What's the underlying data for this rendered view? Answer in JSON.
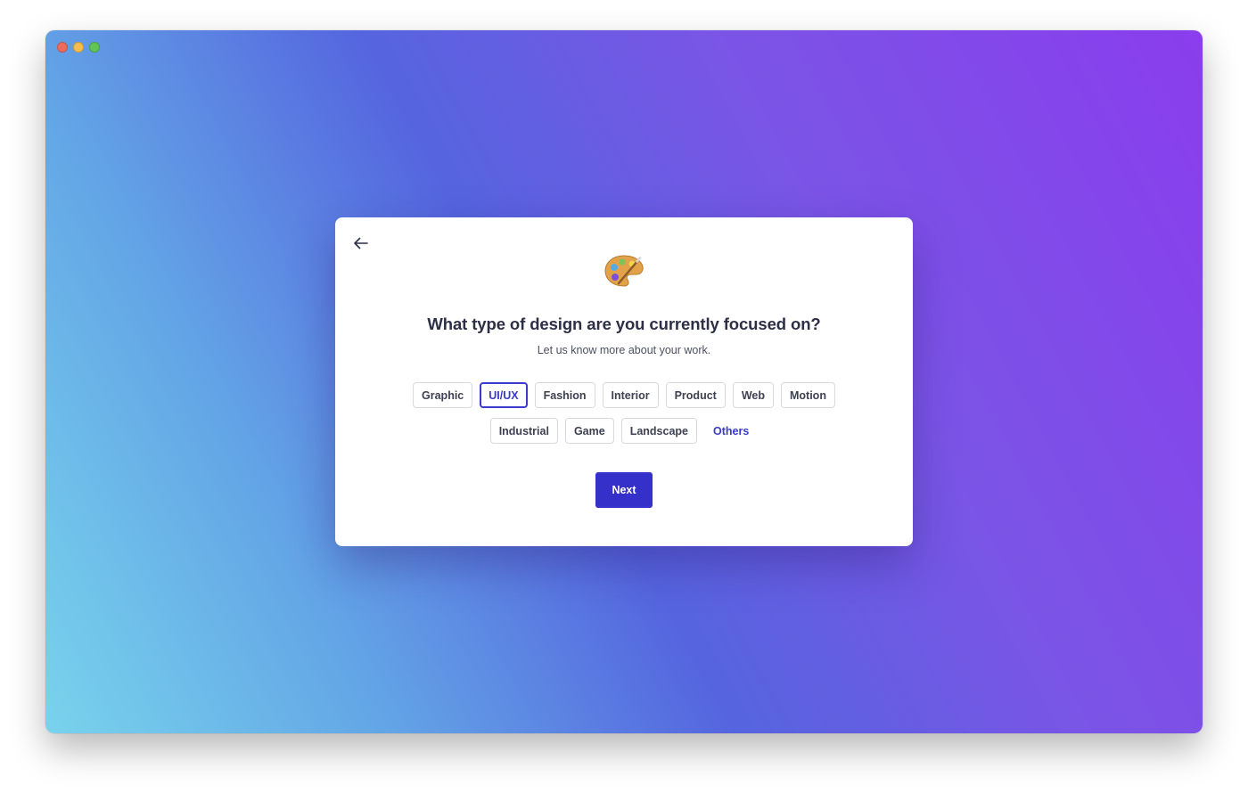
{
  "window": {
    "traffic_lights": [
      "close",
      "minimize",
      "maximize"
    ]
  },
  "dialog": {
    "back_icon": "arrow-left-icon",
    "hero_icon": "artist-palette-icon",
    "title": "What type of design are you currently focused on?",
    "subtitle": "Let us know more about your work.",
    "options_row1": [
      {
        "label": "Graphic",
        "selected": false
      },
      {
        "label": "UI/UX",
        "selected": true
      },
      {
        "label": "Fashion",
        "selected": false
      },
      {
        "label": "Interior",
        "selected": false
      },
      {
        "label": "Product",
        "selected": false
      },
      {
        "label": "Web",
        "selected": false
      },
      {
        "label": "Motion",
        "selected": false
      }
    ],
    "options_row2": [
      {
        "label": "Industrial",
        "selected": false
      },
      {
        "label": "Game",
        "selected": false
      },
      {
        "label": "Landscape",
        "selected": false
      }
    ],
    "others_label": "Others",
    "next_label": "Next"
  },
  "colors": {
    "accent": "#3430c9",
    "selected_border": "#3a3bcc",
    "text_primary": "#2c2f45",
    "text_secondary": "#4b5060"
  }
}
